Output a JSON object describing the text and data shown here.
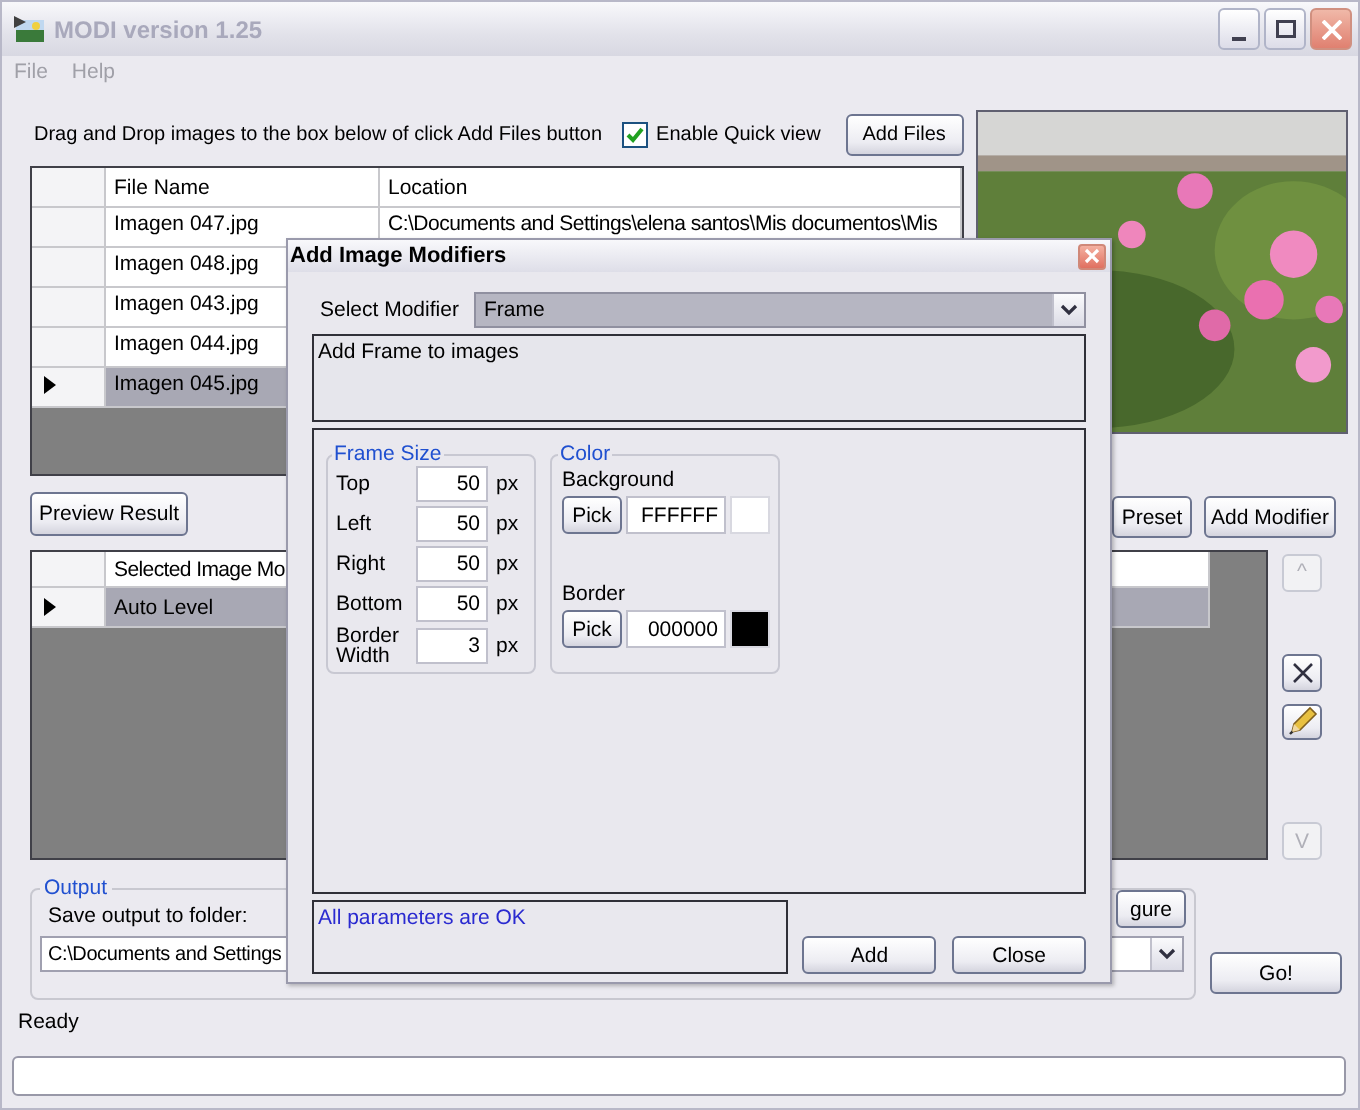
{
  "window": {
    "title": "MODI version 1.25",
    "menu": [
      "File",
      "Help"
    ]
  },
  "instruction": "Drag and Drop images to the box below of click Add Files button",
  "quick_view": {
    "label": "Enable Quick view",
    "checked": true
  },
  "add_files_button": "Add Files",
  "files": {
    "columns": [
      "File Name",
      "Location"
    ],
    "rows": [
      {
        "name": "Imagen 047.jpg",
        "location": "C:\\Documents and Settings\\elena santos\\Mis documentos\\Mis",
        "selected": false
      },
      {
        "name": "Imagen 048.jpg",
        "selected": false
      },
      {
        "name": "Imagen 043.jpg",
        "selected": false
      },
      {
        "name": "Imagen 044.jpg",
        "selected": false
      },
      {
        "name": "Imagen 045.jpg",
        "selected": true
      }
    ]
  },
  "preview_button": "Preview Result",
  "preset_button": "Preset",
  "add_modifier_button": "Add Modifier",
  "modifiers": {
    "columns": [
      "Selected Image Mo"
    ],
    "rows": [
      {
        "name": "Auto Level",
        "selected": true
      }
    ]
  },
  "side_buttons": [
    {
      "kind": "up",
      "label": "^",
      "disabled": true
    },
    {
      "kind": "delete",
      "disabled": false
    },
    {
      "kind": "edit",
      "disabled": false
    },
    {
      "kind": "down",
      "label": "V",
      "disabled": true
    }
  ],
  "output": {
    "legend": "Output",
    "label": "Save output to folder:",
    "path": "C:\\Documents and Settings",
    "configure_button": "gure"
  },
  "go_button": "Go!",
  "status": "Ready",
  "progress": {
    "level": 0
  },
  "dialog": {
    "title": "Add Image Modifiers",
    "select_label": "Select Modifier",
    "modifier": "Frame",
    "description": "Add Frame to images",
    "frame_size": {
      "legend": "Frame Size",
      "fields": [
        {
          "label": "Top",
          "value": "50",
          "unit": "px"
        },
        {
          "label": "Left",
          "value": "50",
          "unit": "px"
        },
        {
          "label": "Right",
          "value": "50",
          "unit": "px"
        },
        {
          "label": "Bottom",
          "value": "50",
          "unit": "px"
        },
        {
          "label": "Border Width",
          "value": "3",
          "unit": "px"
        }
      ]
    },
    "color": {
      "legend": "Color",
      "items": [
        {
          "label": "Background",
          "button": "Pick",
          "value": "FFFFFF",
          "color": "#ffffff"
        },
        {
          "label": "Border",
          "button": "Pick",
          "value": "000000",
          "color": "#000000"
        }
      ]
    },
    "message": "All parameters are OK",
    "buttons": [
      "Add",
      "Close"
    ]
  }
}
